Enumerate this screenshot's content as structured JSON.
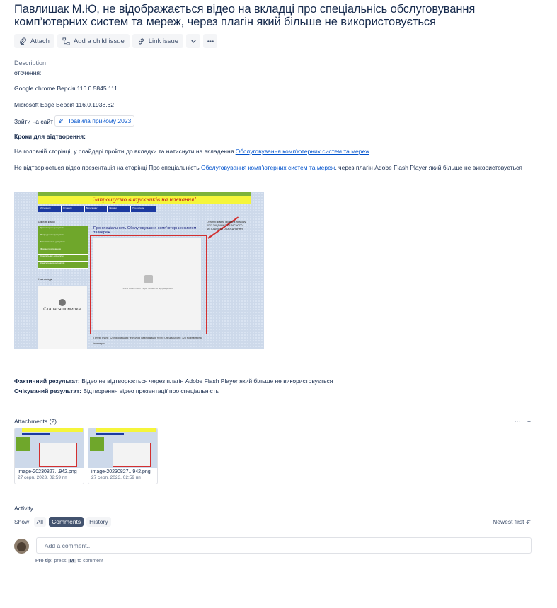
{
  "issue": {
    "title": "Павлишак М.Ю, не відображається відео на вкладці про спеціальнісь обслуговування комп’ютерних систем та мереж, через плагін який більше не використовується"
  },
  "toolbar": {
    "attach": "Attach",
    "add_child": "Add a child issue",
    "link_issue": "Link issue"
  },
  "description": {
    "title": "Description",
    "env": "оточення:",
    "chrome": "Google chrome Версія 116.0.5845.111",
    "edge": "Microsoft Edge Версія 116.0.1938.62",
    "site_prefix": "Зайти на сайт",
    "site_chip": "Правила прийому 2023",
    "steps_title": "Кроки для відтворення:",
    "step1_text": "На головній сторінці, у слайдері пройти до вкладки та натиснути на вкладення",
    "step1_link": "Обслуговування комп'ютерних систем та мереж",
    "step2_text": "Не відтворюється відео презентація на сторінці Про спеціальність",
    "step2_link": "Обслуговування комп’ютерних систем та мереж",
    "step2_tail": ", через плагін Adobe Flash Player який більше не використовується",
    "actual_label": "Фактичний результат:",
    "actual_text": " Відео не відтворюється через плагін Adobe Flash Player який більше не використовується",
    "expected_label": "Очікуваний результат:",
    "expected_text": " Відтворення відео презентації про спеціальність"
  },
  "screenshot": {
    "banner": "Запрошуємо випускників на навчання!",
    "nav": [
      "Абітурієнту",
      "Студенту",
      "Випускнику",
      "Новини",
      "Про коледж"
    ],
    "side_title": "Циклові комісії",
    "side_items": [
      "Гуманітарних дисциплін",
      "Природничих дисциплін",
      "Математичних дисциплін",
      "Фізичного виховання",
      "Спеціальних дисциплін",
      "Комп'ютерних дисциплін"
    ],
    "page_title": "Про спеціальність Обслуговування комп’ютерних систем та мереж",
    "plugin_text": "Плагін Adobe Flash Player більше не підтримується",
    "err_title": "Сталася помилка.",
    "err_sub": "Наш коледж",
    "right_text": "Останні новини  Правила прийому 2023  ЗАВДАННЯ ОБЛАСНОГО МЕТОДИЧНОГО ОБ'ЄДНАННЯ",
    "bottom_text": "Галузь знань: 12 Інформаційні технології  Кваліфікація: технік  Спеціальність: 123 Комп'ютерна інженерія"
  },
  "attachments": {
    "header": "Attachments (2)",
    "items": [
      {
        "name": "image-20230827...942.png",
        "date": "27 серп. 2023, 02:59 пп"
      },
      {
        "name": "image-20230827...942.png",
        "date": "27 серп. 2023, 02:59 пп"
      }
    ]
  },
  "activity": {
    "title": "Activity",
    "show_label": "Show:",
    "filters": [
      "All",
      "Comments",
      "History"
    ],
    "active_filter": "Comments",
    "sort": "Newest first",
    "comment_placeholder": "Add a comment...",
    "protip_label": "Pro tip:",
    "protip_press": "press",
    "protip_key": "M",
    "protip_tail": "to comment"
  },
  "colors": {
    "link": "#0052cc",
    "text": "#172b4d",
    "muted": "#5e6c84",
    "active_pill": "#42526e"
  }
}
